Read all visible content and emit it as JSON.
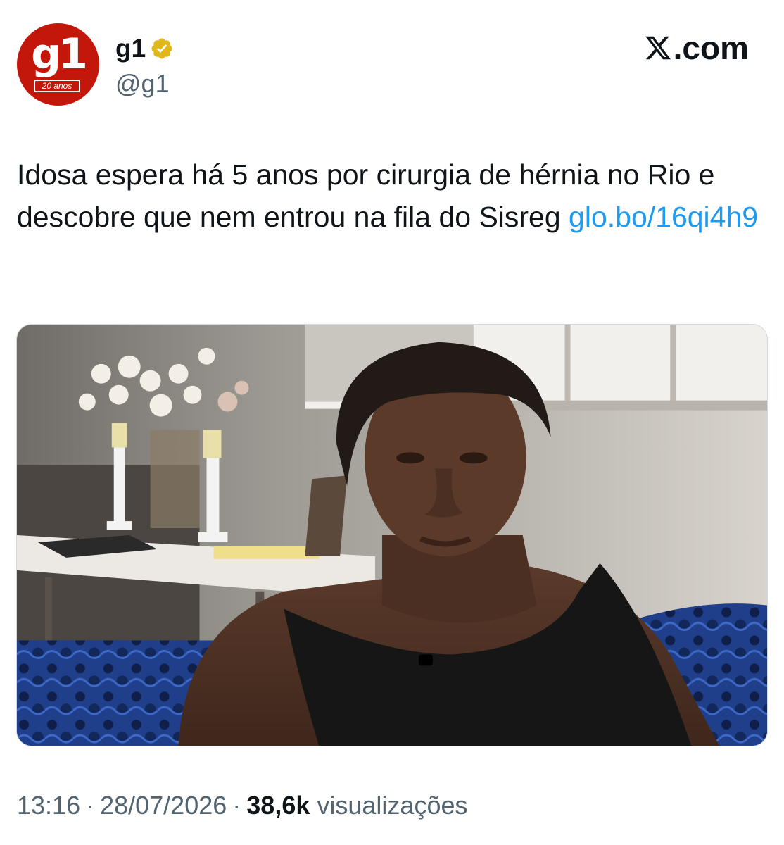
{
  "author": {
    "avatar_logo_text": "g1",
    "avatar_badge_text": "20 anos",
    "display_name": "g1",
    "handle": "@g1",
    "verified_icon": "verified-gold-badge-icon"
  },
  "brand": {
    "label": ".com",
    "icon": "x-logo-icon"
  },
  "tweet": {
    "text_line": "Idosa espera há 5 anos por cirurgia de hérnia no Rio e descobre que nem entrou na fila do Sisreg ",
    "link": "glo.bo/16qi4h9"
  },
  "footer": {
    "time": "13:16",
    "separator": "·",
    "date": "28/07/2026",
    "views_count": "38,6k",
    "views_label": "visualizações"
  },
  "colors": {
    "link": "#1d9bf0",
    "secondary_text": "#536471",
    "g1_red": "#c4170c",
    "verified_gold": "#e2b719"
  }
}
